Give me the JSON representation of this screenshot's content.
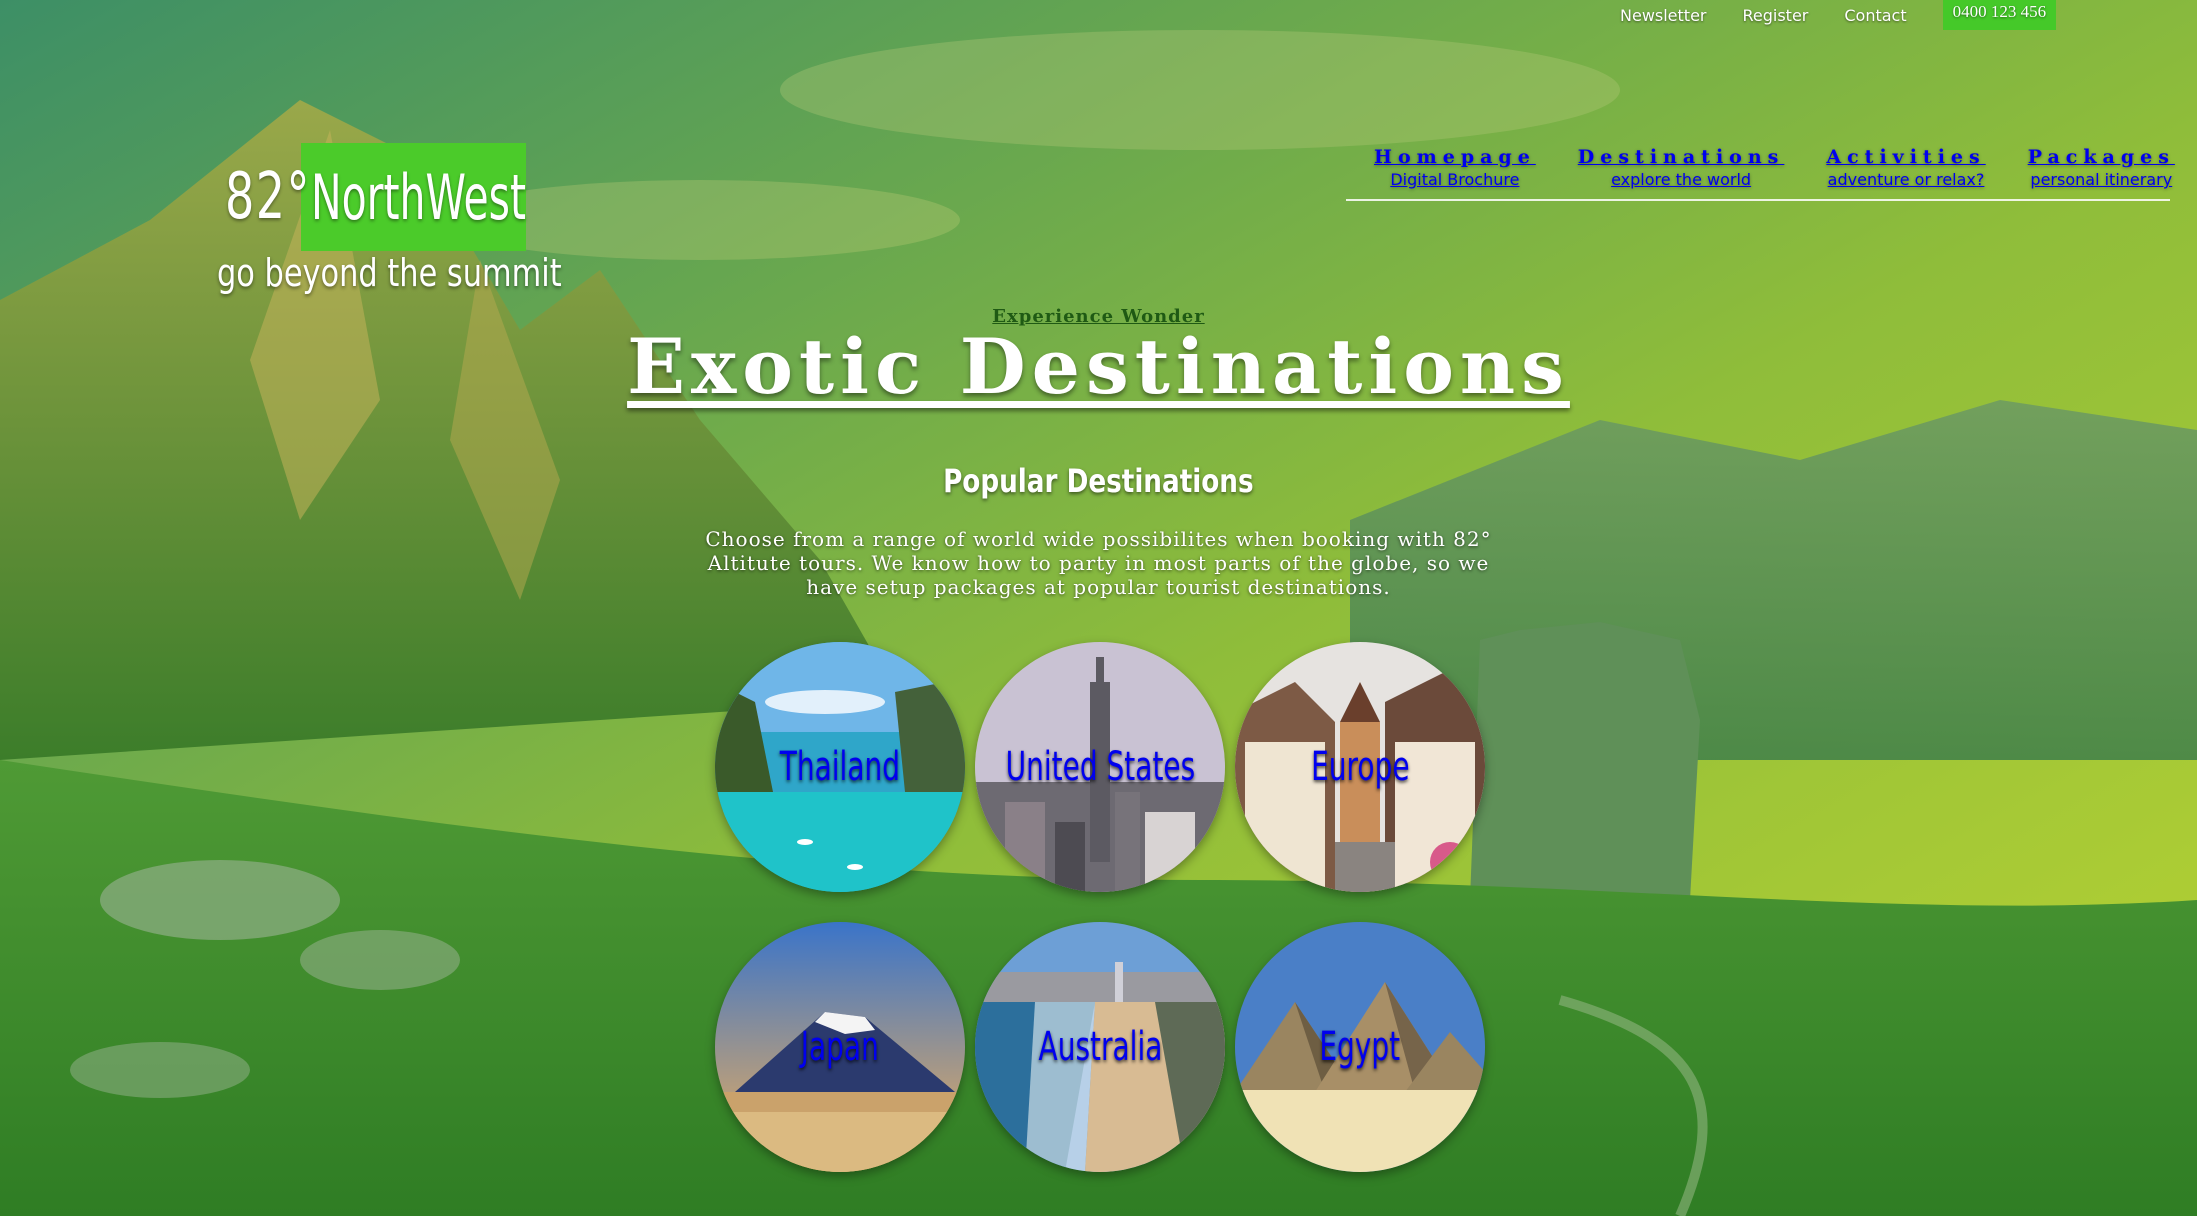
{
  "utility_nav": {
    "newsletter": "Newsletter",
    "register": "Register",
    "contact": "Contact",
    "phone": "0400 123 456"
  },
  "logo": {
    "degree": "82°",
    "brand": "NorthWest",
    "tagline": "go beyond the summit"
  },
  "main_nav": [
    {
      "title": "Homepage",
      "subtitle": "Digital Brochure"
    },
    {
      "title": "Destinations",
      "subtitle": "explore the world"
    },
    {
      "title": "Activities",
      "subtitle": "adventure or relax?"
    },
    {
      "title": "Packages",
      "subtitle": "personal itinerary"
    }
  ],
  "hero": {
    "kicker": "Experience Wonder",
    "title": "Exotic Destinations"
  },
  "popular": {
    "heading": "Popular Destinations",
    "description": "Choose from a range of world wide possibilites when booking with 82° Altitute tours. We know how to party in most parts of the globe, so we have setup packages at popular tourist destinations."
  },
  "destinations": [
    {
      "label": "Thailand"
    },
    {
      "label": "United States"
    },
    {
      "label": "Europe"
    },
    {
      "label": "Japan"
    },
    {
      "label": "Australia"
    },
    {
      "label": "Egypt"
    }
  ],
  "colors": {
    "accent_green": "#4bcb2a",
    "overlay_green": "#3f8a3c",
    "kicker_green": "#1f5a14"
  }
}
